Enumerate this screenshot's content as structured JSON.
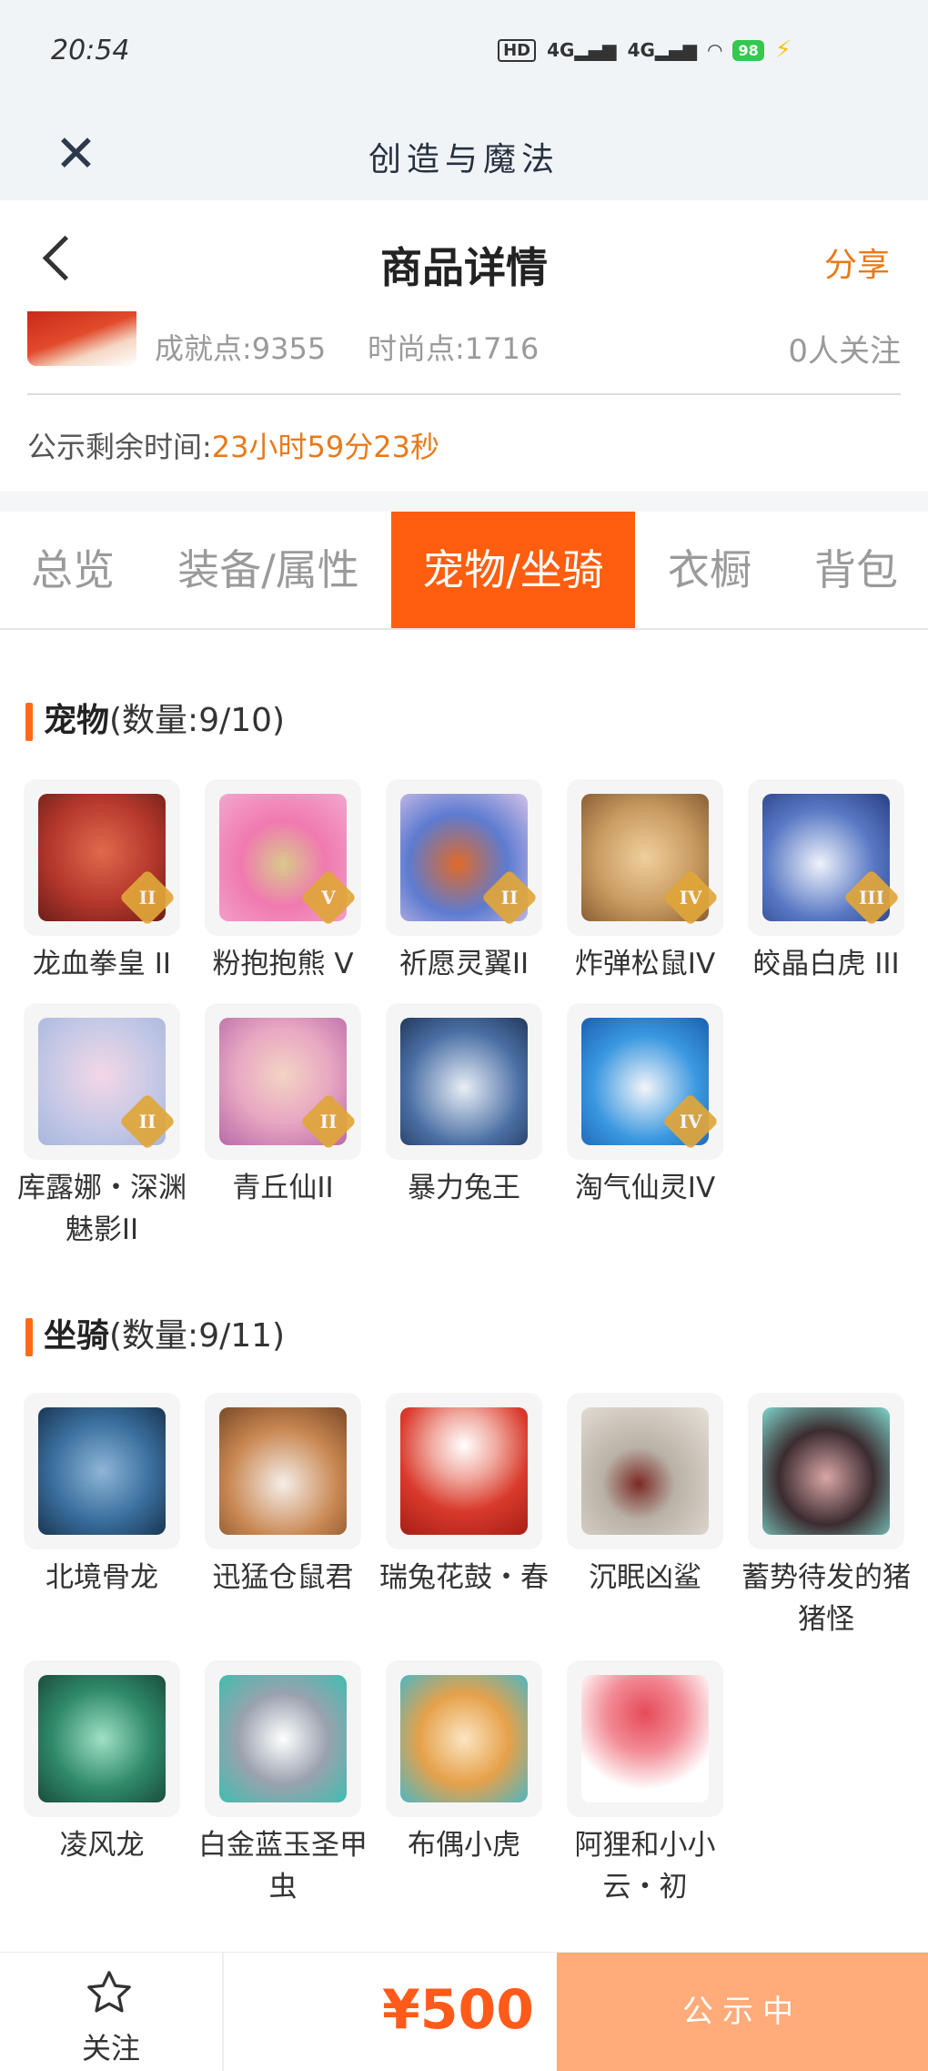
{
  "status_bar": {
    "time": "20:54",
    "hd": "HD",
    "net1": "4G",
    "net2": "4G",
    "battery": "98"
  },
  "app": {
    "title": "创造与魔法"
  },
  "nav": {
    "title": "商品详情",
    "share": "分享"
  },
  "stats": {
    "achievement": "成就点:9355",
    "fashion": "时尚点:1716",
    "followers": "0人关注"
  },
  "notice": {
    "label": "公示剩余时间:",
    "countdown": "23小时59分23秒"
  },
  "tabs": [
    "总览",
    "装备/属性",
    "宠物/坐骑",
    "衣橱",
    "背包"
  ],
  "active_tab": "宠物/坐骑",
  "pets": {
    "title": "宠物",
    "count": "(数量:9/10)",
    "items": [
      {
        "name": "龙血拳皇 II",
        "tier": "II",
        "icon": "pet-dragon-boxer",
        "color": "#b5372c"
      },
      {
        "name": "粉抱抱熊 V",
        "tier": "V",
        "icon": "pet-pink-bear",
        "color": "#f07ab0"
      },
      {
        "name": "祈愿灵翼II",
        "tier": "II",
        "icon": "pet-wing-bird",
        "color": "#5d7bd0"
      },
      {
        "name": "炸弹松鼠IV",
        "tier": "IV",
        "icon": "pet-bomb-squirrel",
        "color": "#c99b62"
      },
      {
        "name": "皎晶白虎 III",
        "tier": "III",
        "icon": "pet-white-tiger",
        "color": "#5878c4"
      },
      {
        "name": "库露娜・深渊魅影II",
        "tier": "II",
        "icon": "pet-kuluna",
        "color": "#c6c9e6"
      },
      {
        "name": "青丘仙II",
        "tier": "II",
        "icon": "pet-fox-fairy",
        "color": "#e8a7c2"
      },
      {
        "name": "暴力兔王",
        "tier": "",
        "icon": "pet-rabbit-king",
        "color": "#4a6fa4"
      },
      {
        "name": "淘气仙灵IV",
        "tier": "IV",
        "icon": "pet-naughty-fairy",
        "color": "#3a98e0"
      }
    ]
  },
  "mounts": {
    "title": "坐骑",
    "count": "(数量:9/11)",
    "items": [
      {
        "name": "北境骨龙",
        "icon": "mount-bone-dragon",
        "color": "#3a6f9e"
      },
      {
        "name": "迅猛仓鼠君",
        "icon": "mount-hamster",
        "color": "#c98752"
      },
      {
        "name": "瑞兔花鼓・春",
        "icon": "mount-rabbit-drum",
        "color": "#d93a2c"
      },
      {
        "name": "沉眠凶鲨",
        "icon": "mount-shark",
        "color": "#b9b1a6"
      },
      {
        "name": "蓄势待发的猪猪怪",
        "icon": "mount-pig",
        "color": "#3c2c30"
      },
      {
        "name": "凌风龙",
        "icon": "mount-wind-dragon",
        "color": "#2f8a6a"
      },
      {
        "name": "白金蓝玉圣甲虫",
        "icon": "mount-scarab",
        "color": "#9aa2ae"
      },
      {
        "name": "布偶小虎",
        "icon": "mount-tiger-doll",
        "color": "#e6a14a"
      },
      {
        "name": "阿狸和小小云・初",
        "icon": "mount-ali-cloud",
        "color": "#e64a5a"
      }
    ]
  },
  "footer": {
    "follow": "关注",
    "price": "¥500",
    "status": "公示中"
  }
}
